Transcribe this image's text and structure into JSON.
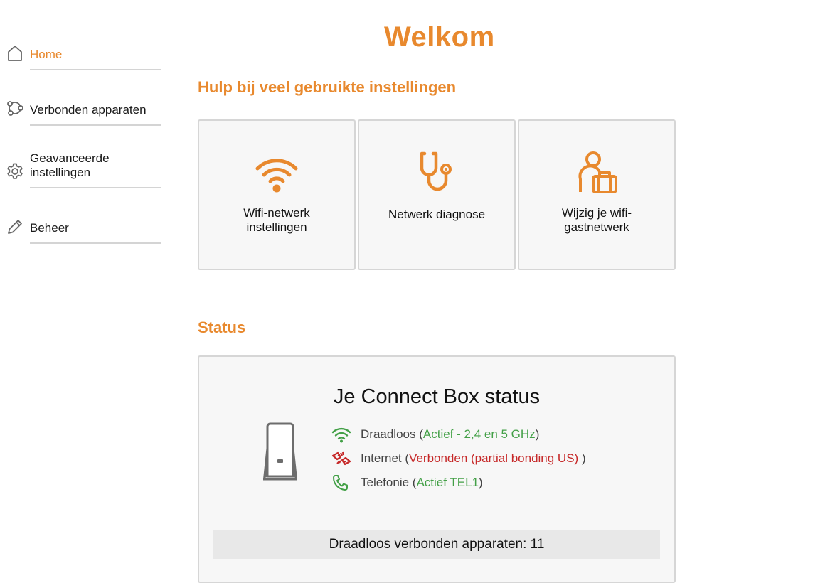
{
  "sidebar": {
    "items": [
      {
        "label": "Home",
        "icon": "home-icon",
        "active": true
      },
      {
        "label": "Verbonden apparaten",
        "icon": "devices-icon",
        "active": false
      },
      {
        "label": "Geavanceerde instellingen",
        "icon": "gear-icon",
        "active": false
      },
      {
        "label": "Beheer",
        "icon": "pencil-icon",
        "active": false
      }
    ]
  },
  "main": {
    "title": "Welkom",
    "help_section_title": "Hulp bij veel gebruikte instellingen",
    "tiles": [
      {
        "label": "Wifi-netwerk instellingen",
        "icon": "wifi-icon"
      },
      {
        "label": "Netwerk diagnose",
        "icon": "stethoscope-icon"
      },
      {
        "label": "Wijzig je wifi-gastnetwerk",
        "icon": "guest-icon"
      }
    ],
    "status_section_title": "Status",
    "status": {
      "title": "Je Connect Box status",
      "rows": [
        {
          "name": "Draadloos",
          "value": "Actief - 2,4 en 5 GHz",
          "state": "ok",
          "icon": "wifi-icon"
        },
        {
          "name": "Internet",
          "value": "Verbonden (partial bonding US) ",
          "state": "error",
          "icon": "broken-link-icon"
        },
        {
          "name": "Telefonie",
          "value": "Actief TEL1",
          "state": "ok",
          "icon": "phone-icon"
        }
      ],
      "devices_text": "Draadloos verbonden apparaten: 11"
    }
  },
  "colors": {
    "accent": "#e8892e",
    "ok": "#43a047",
    "error": "#c62828",
    "border": "#d6d6d6",
    "panel": "#f7f7f7"
  }
}
